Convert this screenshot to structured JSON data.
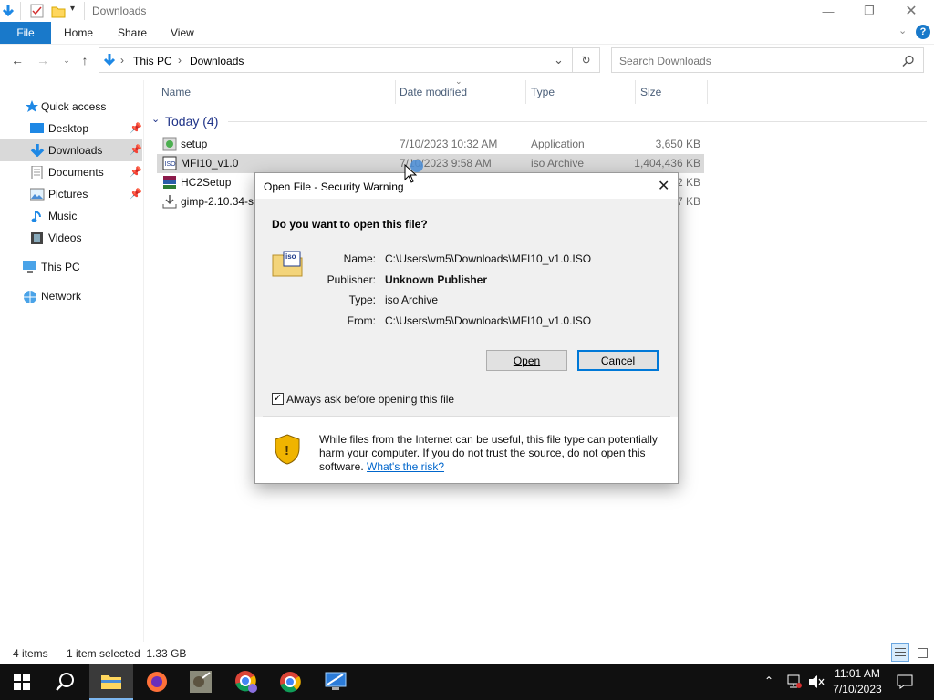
{
  "window": {
    "title": "Downloads"
  },
  "ribbon": {
    "tabs": [
      "File",
      "Home",
      "Share",
      "View"
    ]
  },
  "address": {
    "crumbs": [
      "This PC",
      "Downloads"
    ]
  },
  "search": {
    "placeholder": "Search Downloads"
  },
  "nav": {
    "items": [
      {
        "label": "Quick access",
        "icon": "star-icon"
      },
      {
        "label": "Desktop",
        "icon": "desktop-icon",
        "pinned": true
      },
      {
        "label": "Downloads",
        "icon": "download-arrow-icon",
        "pinned": true,
        "selected": true
      },
      {
        "label": "Documents",
        "icon": "documents-icon",
        "pinned": true
      },
      {
        "label": "Pictures",
        "icon": "pictures-icon",
        "pinned": true
      },
      {
        "label": "Music",
        "icon": "music-note-icon"
      },
      {
        "label": "Videos",
        "icon": "videos-icon"
      },
      {
        "label": "This PC",
        "icon": "computer-icon"
      },
      {
        "label": "Network",
        "icon": "network-icon"
      }
    ]
  },
  "columns": {
    "name": "Name",
    "date": "Date modified",
    "type": "Type",
    "size": "Size"
  },
  "group": {
    "label": "Today (4)"
  },
  "files": [
    {
      "name": "setup",
      "date": "7/10/2023 10:32 AM",
      "type": "Application",
      "size": "3,650 KB",
      "icon": "setup-icon"
    },
    {
      "name": "MFI10_v1.0",
      "date": "7/10/2023 9:58 AM",
      "type": "iso Archive",
      "size": "1,404,436 KB",
      "icon": "iso-archive-icon",
      "selected": true
    },
    {
      "name": "HC2Setup",
      "date": "",
      "type": "",
      "size": "2 KB",
      "icon": "winrar-icon"
    },
    {
      "name": "gimp-2.10.34-se",
      "date": "",
      "type": "",
      "size": "7 KB",
      "icon": "installer-download-icon"
    }
  ],
  "dialog": {
    "title": "Open File - Security Warning",
    "question": "Do you want to open this file?",
    "fields": [
      {
        "label": "Name:",
        "value": "C:\\Users\\vm5\\Downloads\\MFI10_v1.0.ISO"
      },
      {
        "label": "Publisher:",
        "value": "Unknown Publisher"
      },
      {
        "label": "Type:",
        "value": "iso Archive"
      },
      {
        "label": "From:",
        "value": "C:\\Users\\vm5\\Downloads\\MFI10_v1.0.ISO"
      }
    ],
    "open_label": "Open",
    "cancel_label": "Cancel",
    "checkbox_label": "Always ask before opening this file",
    "checkbox_checked": true,
    "warning_text": "While files from the Internet can be useful, this file type can potentially harm your computer. If you do not trust the source, do not open this software.",
    "risk_link": "What's the risk?",
    "file_icon_text": "iso"
  },
  "status": {
    "count": "4 items",
    "selection": "1 item selected  1.33 GB"
  },
  "taskbar": {
    "time": "11:01 AM",
    "date": "7/10/2023"
  },
  "colors": {
    "accent": "#0078d7",
    "file_tab": "#1979ca",
    "selection": "#cce8ff",
    "taskbar": "#101010"
  }
}
